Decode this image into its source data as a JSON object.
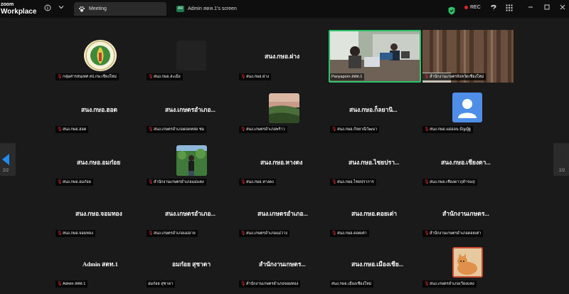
{
  "app": {
    "logo_line1": "zoom",
    "logo_line2": "Workplace"
  },
  "tabs": [
    {
      "label": "Meeting"
    },
    {
      "badge": "AR",
      "label": "Admin สตท.1's screen"
    }
  ],
  "status": {
    "rec": "REC"
  },
  "pager": {
    "left": "2/2",
    "right": "2/2"
  },
  "colors": {
    "bg": "#1a1a1a",
    "active_speaker": "#2dc36a",
    "rec_dot": "#e02828",
    "mic_muted": "#e33333"
  },
  "tiles": [
    {
      "title": "",
      "label": "กลุ่มศารสนเทศ สป.กษ.เชียงใหม่",
      "muted": true
    },
    {
      "title": "",
      "label": "สนง.กษอ.สะเมิง",
      "muted": true
    },
    {
      "title": "สนง.กษอ.ฝาง",
      "label": "สนง.กษอ.ฝาง",
      "muted": true
    },
    {
      "title": "",
      "label": "Panyaporn สตท.1",
      "muted": false
    },
    {
      "title": "",
      "label": "สำนักงานเกษตรจังหวัดเชียงใหม่",
      "muted": true
    },
    {
      "title": "สนง.กษอ.ฮอด",
      "label": "สนง.กษอ.ฮอด",
      "muted": true
    },
    {
      "title": "สนง.เกษตรอำเภอ...",
      "label": "สนง.เกษตรอำเภอดอยหล่อ ชม",
      "muted": true
    },
    {
      "title": "",
      "label": "สนง.เกษตรอำเภอพร้าว",
      "muted": true
    },
    {
      "title": "สนง.กษอ.ก็ลยานิ...",
      "label": "สนง.กษอ.กัลยาณิวัฒนา",
      "muted": true
    },
    {
      "title": "",
      "label": "สนง.กษอ.แม่ออน ธัญญ์ฐ",
      "muted": true
    },
    {
      "title": "สนง.กษอ.อมก๋อย",
      "label": "สนง.กษอ.อมก๋อย",
      "muted": true
    },
    {
      "title": "",
      "label": "สำนักงานเกษตรอำเภอแม่แตง",
      "muted": true
    },
    {
      "title": "สนง.กษอ.หางดง",
      "label": "สนง.กษอ.หางดง",
      "muted": true
    },
    {
      "title": "สนง.กษอ.ไชยปรา...",
      "label": "สนง.กษอ.ไชยปราการ",
      "muted": true
    },
    {
      "title": "สนง.กษอ.เชียงดา...",
      "label": "สนง.กษอ.เชียงดาว(ตำรอง)",
      "muted": true
    },
    {
      "title": "สนง.กษอ.จอมทอง",
      "label": "สนง.กษอ.จอมทอง",
      "muted": true
    },
    {
      "title": "สนง.เกษตรอำเภอ...",
      "label": "สนง.เกษตรอำเภอแม่อาย",
      "muted": true
    },
    {
      "title": "สนง.เกษตรอำเภอ...",
      "label": "สนง.เกษตรอำเภอแม่วาง",
      "muted": true
    },
    {
      "title": "สนง.กษอ.ดอยเต่า",
      "label": "สนง.กษอ.ดอยเต่า",
      "muted": true
    },
    {
      "title": "สำนักงานเกษตร...",
      "label": "สำนักงานเกษตรอำเภอดอยเต่า",
      "muted": true
    },
    {
      "title": "Admin สตท.1",
      "label": "Admin สตท.1",
      "muted": true
    },
    {
      "title": "อมก๋อย สุชาดา",
      "label": "อมก๋อย สุชาดา",
      "muted": false
    },
    {
      "title": "สำนักงานเกษตร...",
      "label": "สำนักงานเกษตรอำเภอจอมทอง",
      "muted": true
    },
    {
      "title": "สนง.กษอ.เมืองเชีย...",
      "label": "สนง.กษอ.เมืองเชียงใหม่",
      "muted": false
    },
    {
      "title": "",
      "label": "สนง.เกษตรอำเภอเวียงแหง",
      "muted": true
    }
  ]
}
